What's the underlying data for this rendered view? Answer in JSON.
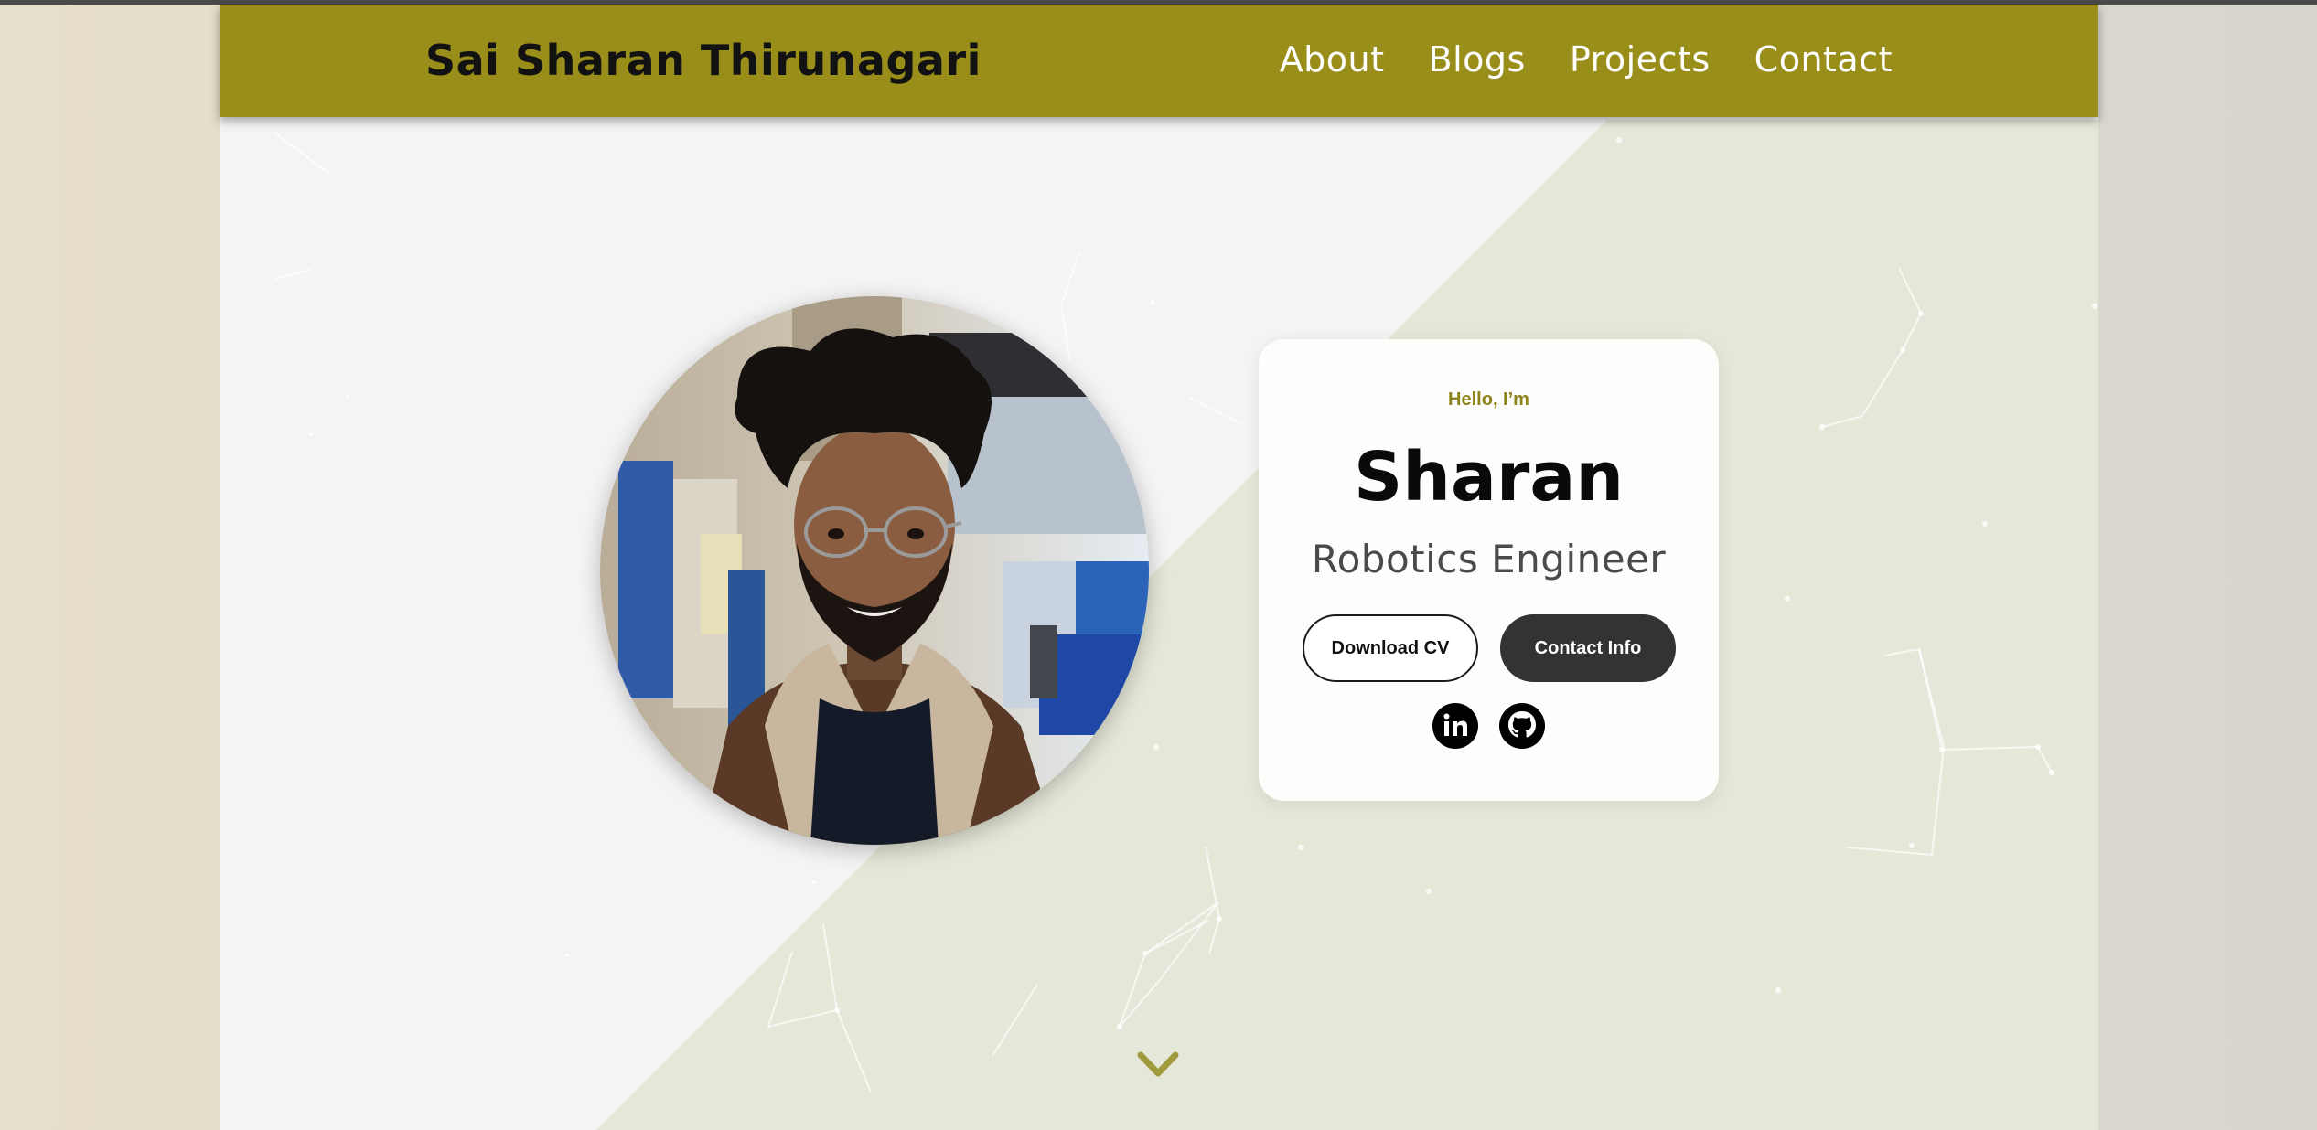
{
  "header": {
    "brand": "Sai Sharan Thirunagari",
    "nav": [
      {
        "label": "About"
      },
      {
        "label": "Blogs"
      },
      {
        "label": "Projects"
      },
      {
        "label": "Contact"
      }
    ]
  },
  "hero": {
    "greeting": "Hello, I’m",
    "name": "Sharan",
    "role": "Robotics Engineer",
    "download_button": "Download CV",
    "contact_button": "Contact Info",
    "social_icons": [
      "linkedin-icon",
      "github-icon"
    ],
    "scroll_icon": "chevron-down-icon"
  },
  "colors": {
    "header_bg": "#9a8e1a",
    "accent": "#8c8319",
    "page_bg": "#f4f4f4",
    "diagonal_bg": "#e5e8d8",
    "dark_button": "#333333"
  }
}
